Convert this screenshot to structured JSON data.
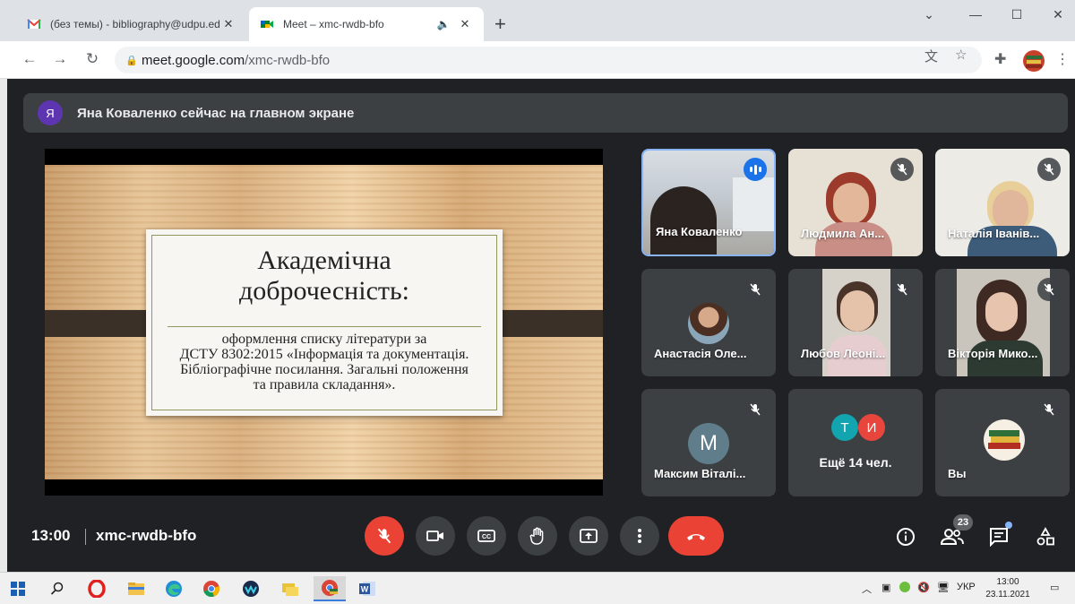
{
  "browser": {
    "tabs": [
      {
        "title": "(без темы) - bibliography@udpu.edu.ua"
      },
      {
        "title": "Meet – xmc-rwdb-bfo"
      }
    ],
    "url_host": "meet.google.com",
    "url_path": "/xmc-rwdb-bfo"
  },
  "meet": {
    "banner": {
      "avatar_letter": "Я",
      "text": "Яна Коваленко сейчас на главном экране"
    },
    "slide": {
      "title_line1": "Академічна",
      "title_line2": "доброчесність:",
      "line1": "оформлення списку літератури за",
      "line2": "ДСТУ 8302:2015 «Інформація та документація.",
      "line3": "Бібліографічне посилання. Загальні положення",
      "line4": "та правила складання»."
    },
    "participants": [
      {
        "name": "Яна Коваленко"
      },
      {
        "name": "Людмила Ан..."
      },
      {
        "name": "Наталія Іванів..."
      },
      {
        "name": "Анастасія Оле..."
      },
      {
        "name": "Любов Леоні..."
      },
      {
        "name": "Вікторія Мико..."
      },
      {
        "name": "Максим Віталі...",
        "avatar_letter": "M",
        "avatar_color": "#607d8b"
      },
      {
        "name": "Вы"
      }
    ],
    "more": {
      "label": "Ещё 14 чел.",
      "avatars": [
        {
          "letter": "Т",
          "color": "#12a4af"
        },
        {
          "letter": "И",
          "color": "#e8453c"
        }
      ]
    },
    "bottom": {
      "time": "13:00",
      "code": "xmc-rwdb-bfo",
      "people_count": "23"
    }
  },
  "taskbar": {
    "lang": "УКР",
    "time": "13:00",
    "date": "23.11.2021"
  }
}
